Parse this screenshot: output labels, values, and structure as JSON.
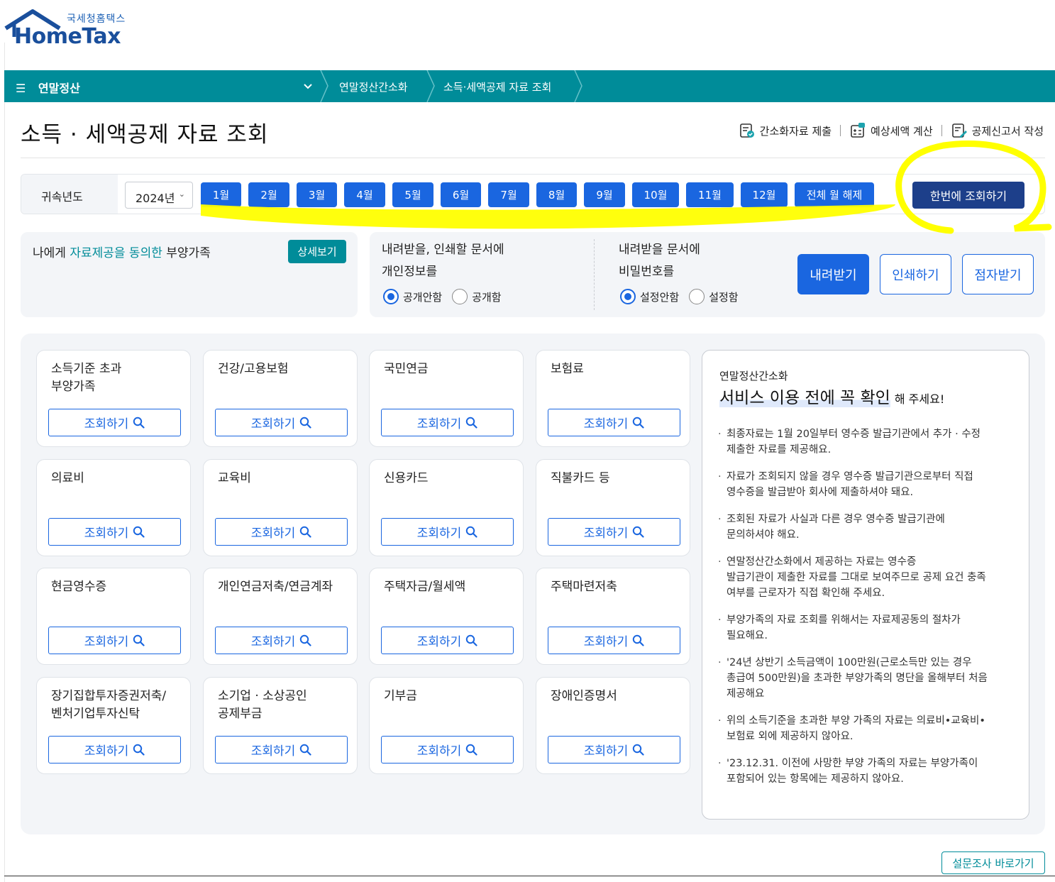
{
  "brand": {
    "korean_name": "국세청홈택스",
    "name": "HomeTax"
  },
  "nav": {
    "menu_label": "연말정산",
    "breadcrumb": [
      "연말정산간소화",
      "소득·세액공제 자료 조회"
    ]
  },
  "page": {
    "title": "소득 · 세액공제 자료 조회",
    "quick_links": [
      {
        "label": "간소화자료 제출",
        "icon": "document-check-icon"
      },
      {
        "label": "예상세액 계산",
        "icon": "calculator-icon"
      },
      {
        "label": "공제신고서 작성",
        "icon": "document-edit-icon"
      }
    ]
  },
  "filter": {
    "year_label": "귀속년도",
    "year_value": "2024년",
    "months": [
      "1월",
      "2월",
      "3월",
      "4월",
      "5월",
      "6월",
      "7월",
      "8월",
      "9월",
      "10월",
      "11월",
      "12월"
    ],
    "clear_all_label": "전체 월 해제",
    "query_all_label": "한번에 조회하기"
  },
  "dependents": {
    "title_prefix": "나에게 ",
    "title_highlight": "자료제공을 동의한",
    "title_suffix": " 부양가족",
    "detail_label": "상세보기"
  },
  "options": {
    "personal_info": {
      "title_line1": "내려받을, 인쇄할 문서에",
      "title_line2": "개인정보를",
      "choices": [
        "공개안함",
        "공개함"
      ],
      "selected": "공개안함"
    },
    "password": {
      "title_line1": "내려받을 문서에",
      "title_line2": "비밀번호를",
      "choices": [
        "설정안함",
        "설정함"
      ],
      "selected": "설정안함"
    },
    "actions": {
      "download": "내려받기",
      "print": "인쇄하기",
      "braille": "점자받기"
    }
  },
  "query_button_label": "조회하기",
  "categories": [
    "소득기준 초과\n부양가족",
    "건강/고용보험",
    "국민연금",
    "보험료",
    "의료비",
    "교육비",
    "신용카드",
    "직불카드 등",
    "현금영수증",
    "개인연금저축/연금계좌",
    "주택자금/월세액",
    "주택마련저축",
    "장기집합투자증권저축/\n벤처기업투자신탁",
    "소기업 · 소상공인\n공제부금",
    "기부금",
    "장애인증명서"
  ],
  "notice": {
    "subtitle": "연말정산간소화",
    "heading": "서비스 이용 전에 꼭 확인",
    "heading_tail": "해 주세요!",
    "items": [
      "최종자료는 1월 20일부터 영수증 발급기관에서 추가 · 수정\n제출한 자료를 제공해요.",
      "자료가 조회되지 않을 경우 영수증 발급기관으로부터 직접\n영수증을 발급받아 회사에 제출하셔야 돼요.",
      "조회된 자료가 사실과 다른 경우 영수증 발급기관에\n문의하셔야 해요.",
      "연말정산간소화에서 제공하는 자료는 영수증\n발급기관이 제출한 자료를 그대로 보여주므로 공제 요건 충족\n여부를 근로자가 직접 확인해 주세요.",
      "부양가족의 자료 조회를 위해서는 자료제공동의 절차가\n필요해요.",
      "'24년 상반기 소득금액이 100만원(근로소득만 있는 경우\n총급여 500만원)을 초과한 부양가족의 명단을 올해부터 처음\n제공해요",
      "위의 소득기준을 초과한 부양 가족의 자료는 의료비•교육비•\n보험료 외에 제공하지 않아요.",
      "'23.12.31. 이전에 사망한 부양 가족의 자료는 부양가족이\n포함되어 있는 항목에는 제공하지 않아요."
    ]
  },
  "survey_label": "설문조사 바로가기",
  "colors": {
    "nav_teal": "#008c99",
    "primary_blue": "#1a66e0",
    "dark_navy": "#1d3f8a",
    "annotation_yellow": "#ffff00"
  }
}
